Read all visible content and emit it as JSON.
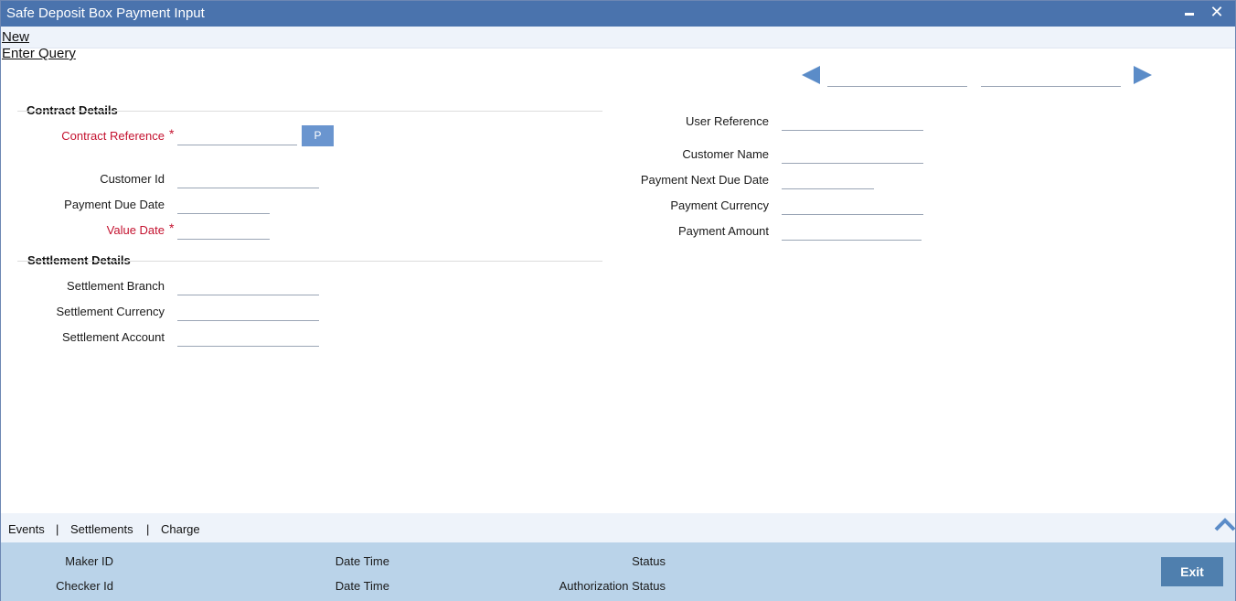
{
  "window": {
    "title": "Safe Deposit Box Payment Input",
    "minimize_icon": "minimize-icon",
    "close_icon": "close-icon",
    "close_glyph": "✕"
  },
  "toolbar": {
    "new_label": "New",
    "enter_query_label": "Enter Query"
  },
  "record_nav": {
    "prev_icon": "arrow-left-icon",
    "next_icon": "arrow-right-icon",
    "field1_value": "",
    "field2_value": ""
  },
  "contract_details": {
    "title": "Contract Details",
    "contract_reference": {
      "label": "Contract Reference",
      "required_mark": "*",
      "value": ""
    },
    "p_button": "P",
    "customer_id": {
      "label": "Customer Id",
      "value": ""
    },
    "payment_due_date": {
      "label": "Payment Due Date",
      "value": ""
    },
    "value_date": {
      "label": "Value Date",
      "required_mark": "*",
      "value": ""
    },
    "user_reference": {
      "label": "User Reference",
      "value": ""
    },
    "customer_name": {
      "label": "Customer Name",
      "value": ""
    },
    "payment_next_due_date": {
      "label": "Payment Next Due Date",
      "value": ""
    },
    "payment_currency": {
      "label": "Payment Currency",
      "value": ""
    },
    "payment_amount": {
      "label": "Payment Amount",
      "value": ""
    }
  },
  "settlement_details": {
    "title": "Settlement Details",
    "settlement_branch": {
      "label": "Settlement Branch",
      "value": ""
    },
    "settlement_currency": {
      "label": "Settlement Currency",
      "value": ""
    },
    "settlement_account": {
      "label": "Settlement Account",
      "value": ""
    }
  },
  "tabs": {
    "events": "Events",
    "settlements": "Settlements",
    "charge": "Charge",
    "separator": "|",
    "collapse_icon": "chevron-up-icon"
  },
  "footer": {
    "maker_id": "Maker ID",
    "checker_id": "Checker Id",
    "date_time_1": "Date Time",
    "date_time_2": "Date Time",
    "status": "Status",
    "authorization_status": "Authorization Status",
    "exit_label": "Exit"
  },
  "colors": {
    "titlebar": "#4a73ad",
    "required_label": "#c4122f",
    "footer": "#bad3e9",
    "exit_button": "#4f7fae",
    "nav_arrow": "#5b8cc8"
  }
}
